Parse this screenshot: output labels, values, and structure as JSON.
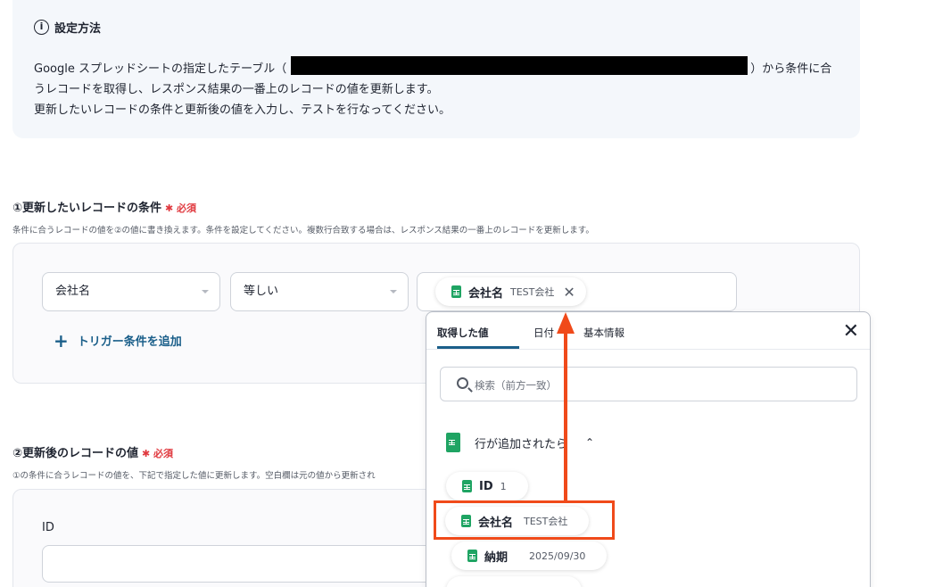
{
  "info": {
    "title": "設定方法",
    "line1_pre": "Google スプレッドシートの指定したテーブル（",
    "line1_post": "）から条件に合",
    "line2": "うレコードを取得し、レスポンス結果の一番上のレコードの値を更新します。",
    "line3": "更新したいレコードの条件と更新後の値を入力し、テストを行なってください。"
  },
  "section1": {
    "title": "①更新したいレコードの条件",
    "required": "✱ 必須",
    "description": "条件に合うレコードの値を②の値に書き換えます。条件を設定してください。複数行合致する場合は、レスポンス結果の一番上のレコードを更新します。",
    "field_select": "会社名",
    "operator_select": "等しい",
    "value_chip": {
      "label": "会社名",
      "value": "TEST会社"
    },
    "add_trigger": "トリガー条件を追加"
  },
  "section2": {
    "title": "②更新後のレコードの値",
    "required": "✱ 必須",
    "description": "①の条件に合うレコードの値を、下記で指定した値に更新します。空白欄は元の値から更新され",
    "id_label": "ID"
  },
  "popup": {
    "tabs": [
      "取得した値",
      "日付",
      "基本情報"
    ],
    "active_tab": "取得した値",
    "search_placeholder": "検索（前方一致）",
    "group_label": "行が追加されたら",
    "items": [
      {
        "label": "ID",
        "value": "1"
      },
      {
        "label": "会社名",
        "value": "TEST会社"
      },
      {
        "label": "納期",
        "value": "2025/09/30"
      }
    ]
  },
  "colors": {
    "accent": "#1b5f8a",
    "highlight": "#f04a1a",
    "required": "#e0383e",
    "sheet_green": "#1fa463"
  },
  "icons": [
    "info-icon",
    "chevron-down-icon",
    "spreadsheet-icon",
    "close-icon",
    "plus-icon",
    "search-icon",
    "chevron-up-icon",
    "arrow-up-icon"
  ]
}
